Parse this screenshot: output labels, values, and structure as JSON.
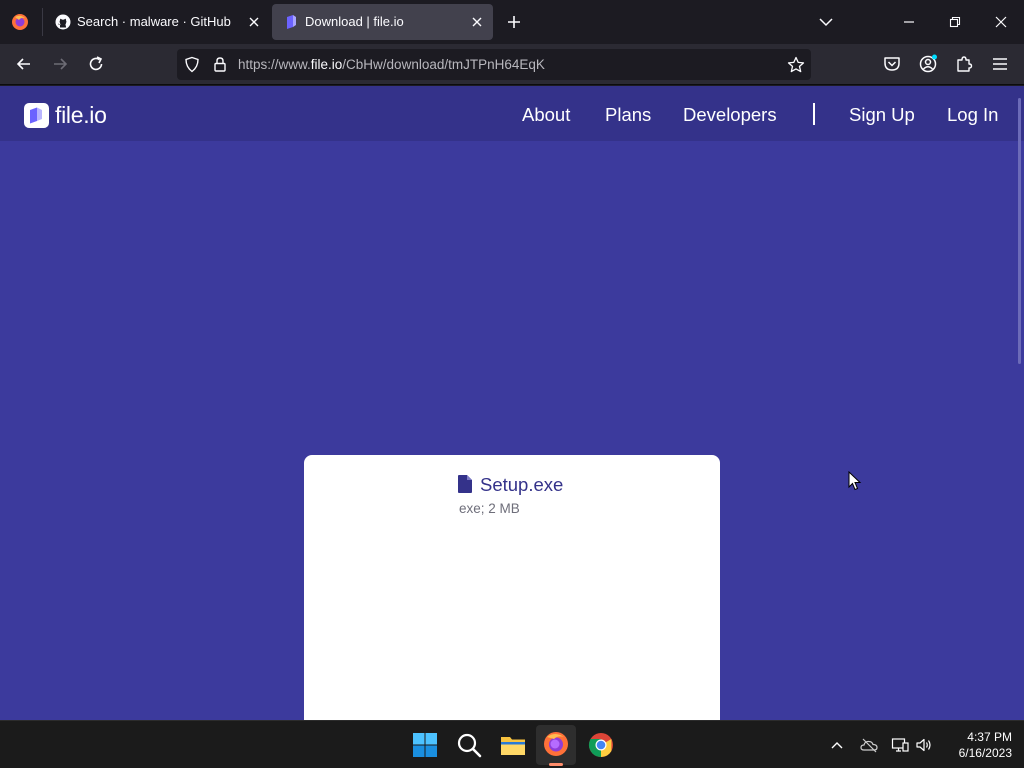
{
  "browser": {
    "tabs": [
      {
        "title": "Search · malware · GitHub",
        "active": false
      },
      {
        "title": "Download | file.io",
        "active": true
      }
    ],
    "url": {
      "prefix": "https://www.",
      "host": "file.io",
      "path": "/CbHw/download/tmJTPnH64EqK"
    }
  },
  "site": {
    "logo_text": "file.io",
    "nav": {
      "about": "About",
      "plans": "Plans",
      "developers": "Developers",
      "signup": "Sign Up",
      "login": "Log In"
    },
    "file": {
      "name": "Setup.exe",
      "meta": "exe; 2 MB"
    }
  },
  "taskbar": {
    "time": "4:37 PM",
    "date": "6/16/2023"
  },
  "colors": {
    "page_bg": "#3c3a9d",
    "header_bg": "#34328a",
    "accent": "#34328a",
    "card_bg": "#ffffff"
  }
}
